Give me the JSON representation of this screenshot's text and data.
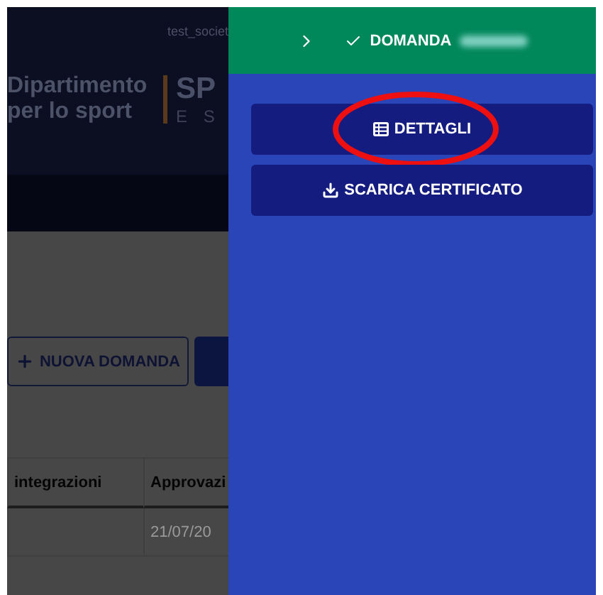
{
  "background_page": {
    "user": "test_societ",
    "logo": {
      "line_1": "Dipartimento",
      "line_2": "per lo sport",
      "brand_1": "SP",
      "brand_2": "E S"
    },
    "new_button": {
      "label": "NUOVA DOMANDA"
    },
    "table": {
      "columns": [
        "integrazioni",
        "Approvazi"
      ],
      "rows": [
        {
          "column_2": "21/07/20"
        }
      ]
    }
  },
  "panel": {
    "header": {
      "title": "DOMANDA"
    },
    "buttons": [
      {
        "kind": "details",
        "label": "DETTAGLI",
        "highlighted": true
      },
      {
        "kind": "download",
        "label": "SCARICA CERTIFICATO",
        "highlighted": false
      }
    ]
  }
}
